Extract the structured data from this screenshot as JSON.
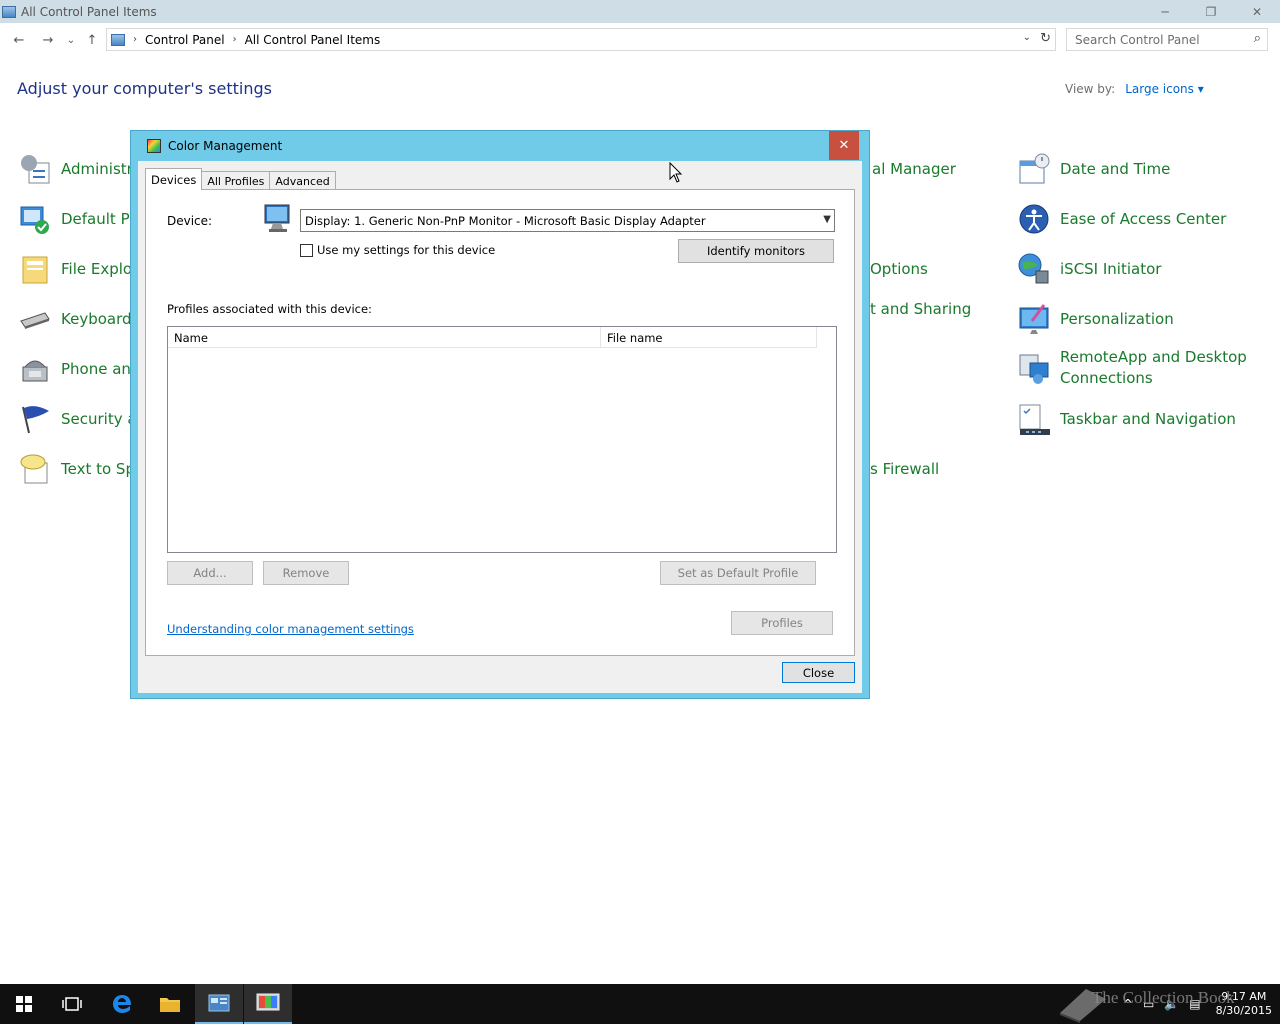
{
  "window": {
    "title": "All Control Panel Items",
    "minimize_icon": "─",
    "restore_icon": "❐",
    "close_icon": "✕"
  },
  "nav": {
    "back": "←",
    "forward": "→",
    "recent": "⌄",
    "up": "↑",
    "breadcrumbs": [
      "Control Panel",
      "All Control Panel Items"
    ],
    "separator": "›",
    "address_dropdown": "⌄",
    "refresh": "↻",
    "search_placeholder": "Search Control Panel",
    "search_icon": "⌕"
  },
  "main": {
    "heading": "Adjust your computer's settings",
    "view_by_label": "View by:",
    "view_by_value": "Large icons ▾"
  },
  "items_left": [
    {
      "label": "Administr",
      "icon": "admin-tools-icon"
    },
    {
      "label": "Default Pr",
      "icon": "default-programs-icon"
    },
    {
      "label": "File Explor",
      "icon": "file-explorer-options-icon"
    },
    {
      "label": "Keyboard",
      "icon": "keyboard-icon"
    },
    {
      "label": "Phone and",
      "icon": "phone-modem-icon"
    },
    {
      "label": "Security a",
      "icon": "security-maintenance-icon"
    },
    {
      "label": "Text to Spe",
      "icon": "text-to-speech-icon"
    }
  ],
  "items_mid": [
    {
      "label": "al Manager"
    },
    {
      "label": "Options"
    },
    {
      "label": "t and Sharing"
    },
    {
      "label": "s Firewall"
    }
  ],
  "items_right": [
    {
      "label": "Date and Time",
      "icon": "date-time-icon"
    },
    {
      "label": "Ease of Access Center",
      "icon": "ease-of-access-icon"
    },
    {
      "label": "iSCSI Initiator",
      "icon": "iscsi-initiator-icon"
    },
    {
      "label": "Personalization",
      "icon": "personalization-icon"
    },
    {
      "label": "RemoteApp and Desktop Connections",
      "icon": "remoteapp-icon"
    },
    {
      "label": "Taskbar and Navigation",
      "icon": "taskbar-navigation-icon"
    }
  ],
  "dialog": {
    "title": "Color Management",
    "close_icon": "✕",
    "tabs": [
      "Devices",
      "All Profiles",
      "Advanced"
    ],
    "device_label": "Device:",
    "device_value": "Display: 1. Generic Non-PnP Monitor - Microsoft Basic Display Adapter",
    "use_settings_label": "Use my settings for this device",
    "identify_button": "Identify monitors",
    "profiles_label": "Profiles associated with this device:",
    "columns": [
      "Name",
      "File name"
    ],
    "add_button": "Add...",
    "remove_button": "Remove",
    "set_default_button": "Set as Default Profile",
    "help_link": "Understanding color management settings",
    "profiles_button": "Profiles",
    "close_button": "Close"
  },
  "tray": {
    "watermark": "The Collection Book",
    "time": "9:17 AM",
    "date": "8/30/2015"
  }
}
